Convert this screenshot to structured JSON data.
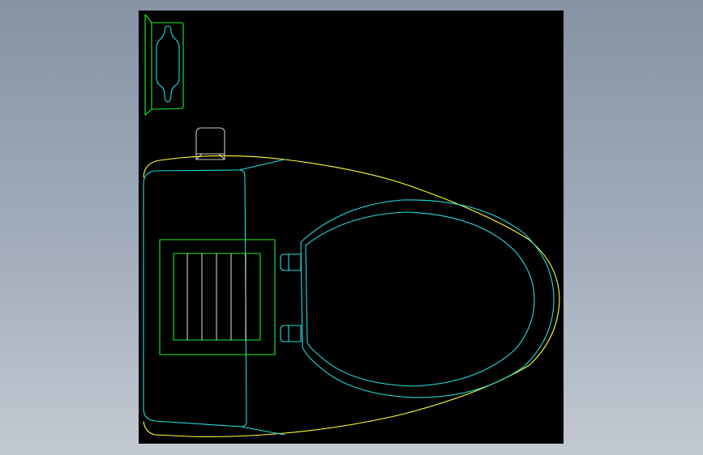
{
  "colors": {
    "background": "#8a98aa",
    "viewport": "#000000",
    "outline_yellow": "#ffff33",
    "outline_cyan": "#22dddd",
    "outline_green": "#22ee22",
    "outline_white": "#c8c8c8"
  },
  "drawing": {
    "subject": "toilet-plan-view",
    "layers": [
      "bowl-outline",
      "seat",
      "tank",
      "flush-panel",
      "handle",
      "paper-holder"
    ]
  }
}
